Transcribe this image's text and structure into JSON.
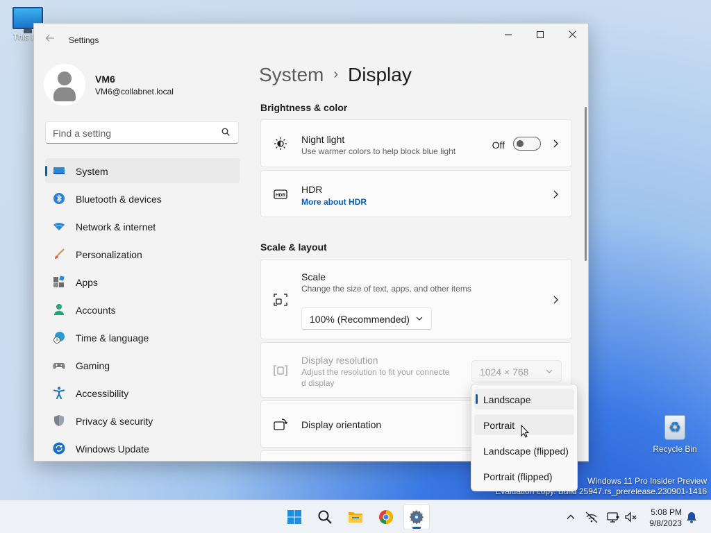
{
  "desktop": {
    "this_pc_label": "This PC",
    "recycle_bin_label": "Recycle Bin",
    "watermark_line1": "Windows 11 Pro Insider Preview",
    "watermark_line2": "Evaluation copy. Build 25947.rs_prerelease.230901-1416"
  },
  "window": {
    "app_title": "Settings",
    "back_icon": "back-arrow-icon",
    "minimize_icon": "minimize-icon",
    "maximize_icon": "maximize-icon",
    "close_icon": "close-icon"
  },
  "profile": {
    "name": "VM6",
    "email": "VM6@collabnet.local"
  },
  "search": {
    "placeholder": "Find a setting",
    "value": ""
  },
  "sidebar": {
    "items": [
      {
        "label": "System",
        "icon": "system-icon",
        "selected": true
      },
      {
        "label": "Bluetooth & devices",
        "icon": "bluetooth-icon"
      },
      {
        "label": "Network & internet",
        "icon": "wifi-icon"
      },
      {
        "label": "Personalization",
        "icon": "brush-icon"
      },
      {
        "label": "Apps",
        "icon": "apps-icon"
      },
      {
        "label": "Accounts",
        "icon": "accounts-icon"
      },
      {
        "label": "Time & language",
        "icon": "globe-clock-icon"
      },
      {
        "label": "Gaming",
        "icon": "gamepad-icon"
      },
      {
        "label": "Accessibility",
        "icon": "accessibility-icon"
      },
      {
        "label": "Privacy & security",
        "icon": "shield-icon"
      },
      {
        "label": "Windows Update",
        "icon": "update-icon"
      }
    ]
  },
  "breadcrumb": {
    "parent": "System",
    "separator": "›",
    "current": "Display"
  },
  "brightness": {
    "section_title": "Brightness & color",
    "night_light": {
      "title": "Night light",
      "subtitle": "Use warmer colors to help block blue light",
      "toggle_state": "Off"
    },
    "hdr": {
      "title": "HDR",
      "link": "More about HDR"
    }
  },
  "scale_layout": {
    "section_title": "Scale & layout",
    "scale": {
      "title": "Scale",
      "subtitle": "Change the size of text, apps, and other items",
      "value": "100% (Recommended)"
    },
    "resolution": {
      "title": "Display resolution",
      "subtitle_line1": "Adjust the resolution to fit your connecte",
      "subtitle_line2": "d display",
      "value": "1024 × 768"
    },
    "orientation": {
      "title": "Display orientation"
    }
  },
  "orientation_menu": {
    "options": [
      "Landscape",
      "Portrait",
      "Landscape (flipped)",
      "Portrait (flipped)"
    ],
    "selected": "Landscape",
    "hovered": "Portrait"
  },
  "taskbar": {
    "apps": [
      "start-icon",
      "search-icon",
      "file-explorer-icon",
      "chrome-icon",
      "settings-icon"
    ],
    "active_app": "settings-icon",
    "tray_icons": [
      "chevron-up-icon",
      "network-off-icon",
      "display-icon",
      "volume-mute-icon",
      "notification-bell-icon"
    ],
    "time": "5:08 PM",
    "date": "9/8/2023"
  },
  "colors": {
    "accent": "#005fb8",
    "window_bg": "#f3f3f3",
    "card_bg": "#fbfbfb"
  }
}
